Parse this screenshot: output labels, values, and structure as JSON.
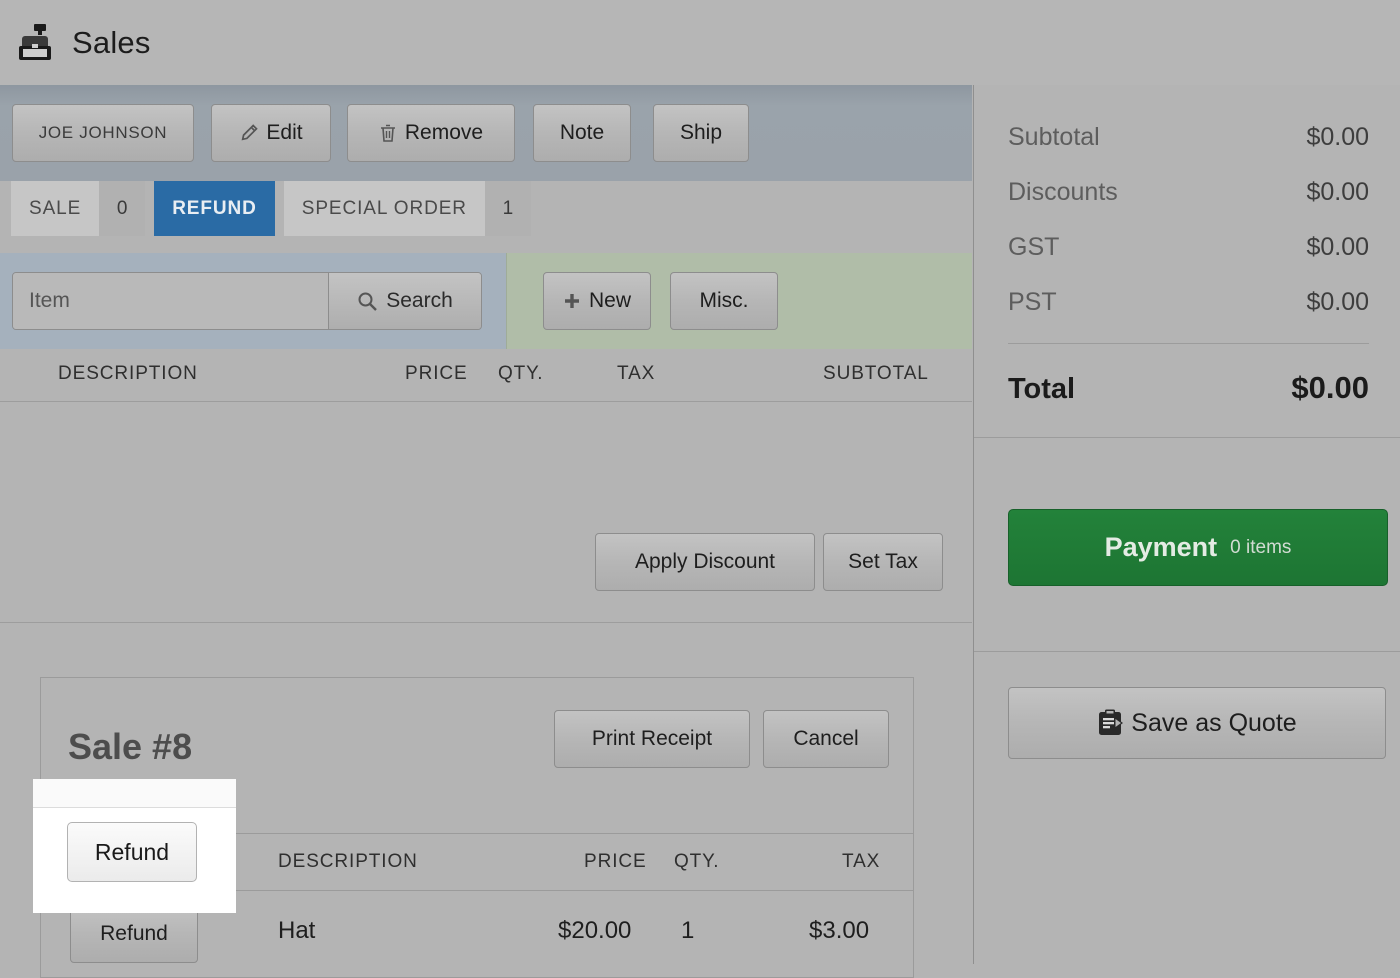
{
  "app": {
    "title": "Sales",
    "icon": "cash-register-icon"
  },
  "customer_bar": {
    "customer_name": "JOE JOHNSON",
    "edit_label": "Edit",
    "remove_label": "Remove",
    "note_label": "Note",
    "ship_label": "Ship"
  },
  "tabs": [
    {
      "label": "SALE",
      "count": "0",
      "active": false
    },
    {
      "label": "REFUND",
      "count": "",
      "active": true
    },
    {
      "label": "SPECIAL ORDER",
      "count": "1",
      "active": false
    }
  ],
  "search": {
    "placeholder": "Item",
    "value": "",
    "search_label": "Search",
    "new_label": "New",
    "misc_label": "Misc."
  },
  "cart_columns": {
    "description": "DESCRIPTION",
    "price": "PRICE",
    "qty": "QTY.",
    "tax": "TAX",
    "subtotal": "SUBTOTAL"
  },
  "cart_actions": {
    "apply_discount": "Apply Discount",
    "set_tax": "Set Tax"
  },
  "sale_card": {
    "title": "Sale #8",
    "print_receipt": "Print Receipt",
    "cancel": "Cancel",
    "columns": {
      "description": "DESCRIPTION",
      "price": "PRICE",
      "qty": "QTY.",
      "tax": "TAX"
    },
    "rows": [
      {
        "action": "Refund",
        "description": "Hat",
        "price": "$20.00",
        "qty": "1",
        "tax": "$3.00"
      }
    ]
  },
  "totals": {
    "rows": [
      {
        "label": "Subtotal",
        "value": "$0.00"
      },
      {
        "label": "Discounts",
        "value": "$0.00"
      },
      {
        "label": "GST",
        "value": "$0.00"
      },
      {
        "label": "PST",
        "value": "$0.00"
      }
    ],
    "total_label": "Total",
    "total_value": "$0.00"
  },
  "actions": {
    "payment_label": "Payment",
    "payment_items": "0 items",
    "save_quote_label": "Save as Quote",
    "save_quote_icon": "clipboard-icon"
  },
  "colors": {
    "accent_blue": "#2a6ba5",
    "payment_green": "#23823a",
    "page_bg": "#b4b4b4",
    "customer_bar": "#9aa2aa",
    "search_zone": "#a5b1bd",
    "new_zone": "#b0bda8"
  }
}
